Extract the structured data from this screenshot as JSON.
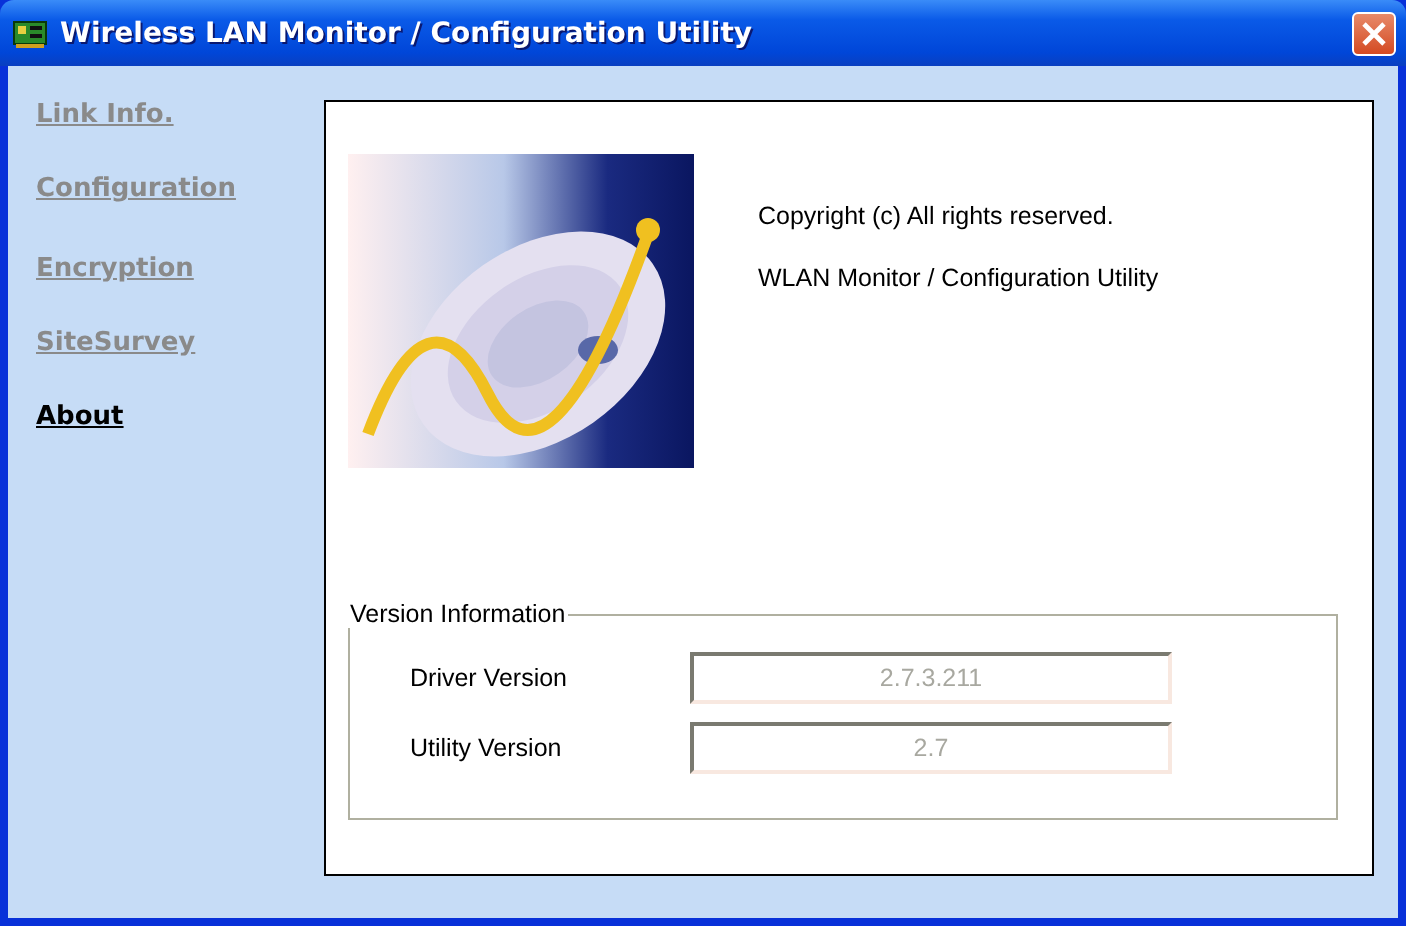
{
  "window": {
    "title": "Wireless LAN Monitor / Configuration Utility"
  },
  "sidebar": {
    "items": [
      {
        "label": "Link Info.",
        "selected": false
      },
      {
        "label": "Configuration",
        "selected": false
      },
      {
        "label": "Encryption",
        "selected": false
      },
      {
        "label": "SiteSurvey",
        "selected": false
      },
      {
        "label": "About",
        "selected": true
      }
    ]
  },
  "about": {
    "lines": [
      "Copyright (c)  All rights reserved.",
      "WLAN Monitor / Configuration Utility"
    ],
    "version_group": {
      "title": "Version Information",
      "fields": [
        {
          "label": "Driver Version",
          "value": "2.7.3.211",
          "disabled": true
        },
        {
          "label": "Utility Version",
          "value": "2.7",
          "disabled": true
        }
      ]
    }
  }
}
